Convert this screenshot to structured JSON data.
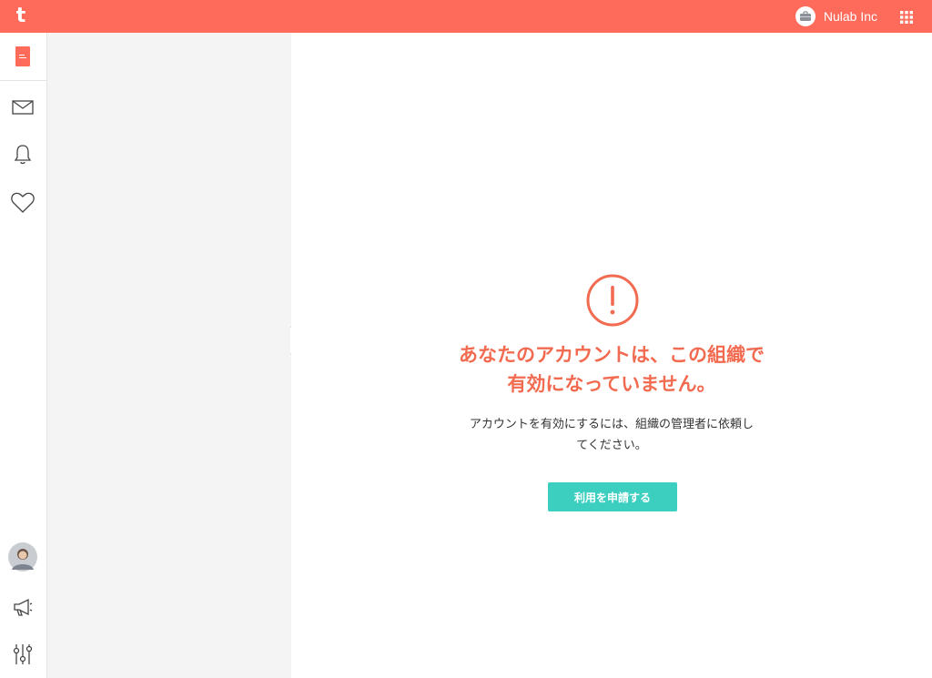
{
  "header": {
    "logo_text": "t",
    "org_name": "Nulab Inc",
    "brand_color": "#ff6b5b"
  },
  "rail": {
    "top_icon": "document-icon",
    "items": [
      {
        "icon": "mail-icon"
      },
      {
        "icon": "bell-icon"
      },
      {
        "icon": "heart-icon"
      }
    ],
    "bottom": [
      {
        "icon": "user-avatar"
      },
      {
        "icon": "megaphone-icon"
      },
      {
        "icon": "settings-sliders-icon"
      }
    ]
  },
  "main": {
    "title_line1": "あなたのアカウントは、この組織で",
    "title_line2": "有効になっていません。",
    "message_line1": "アカウントを有効にするには、組織の管理者に依頼し",
    "message_line2": "てください。",
    "button_label": "利用を申請する",
    "accent_color": "#f26b51",
    "button_color": "#3ccfc0"
  }
}
